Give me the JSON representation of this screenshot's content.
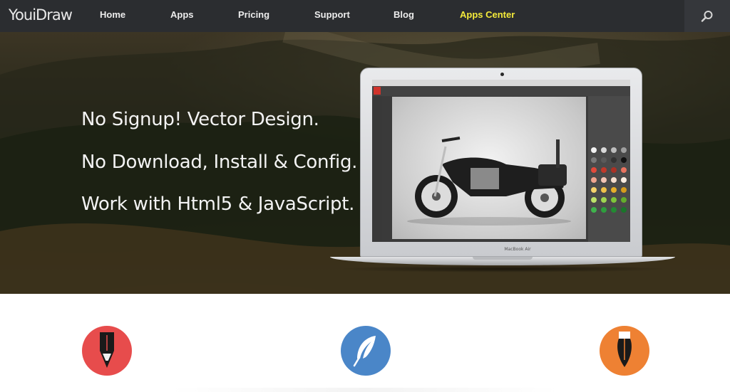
{
  "header": {
    "logo": "YouiDraw",
    "nav": [
      {
        "label": "Home"
      },
      {
        "label": "Apps"
      },
      {
        "label": "Pricing"
      },
      {
        "label": "Support"
      },
      {
        "label": "Blog"
      },
      {
        "label": "Apps Center"
      }
    ],
    "search_icon": "search-icon"
  },
  "hero": {
    "taglines": [
      "No Signup! Vector Design.",
      "No Download, Install & Config.",
      "Work with Html5 & JavaScript."
    ],
    "laptop_caption": "MacBook Air"
  },
  "features": [
    {
      "icon": "pencil-icon",
      "color": "#e74c4c"
    },
    {
      "icon": "feather-icon",
      "color": "#4a86c8"
    },
    {
      "icon": "ink-brush-icon",
      "color": "#ee8133"
    }
  ],
  "colors": {
    "nav_bg": "#2b2d30",
    "nav_active": "#f4ea3a",
    "nav_text": "#ececec"
  }
}
